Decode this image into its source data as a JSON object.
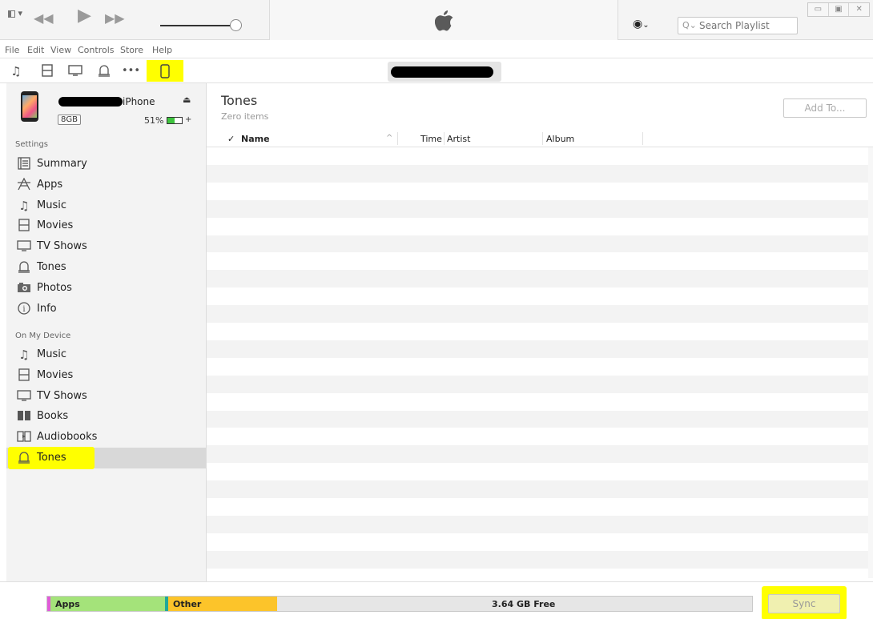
{
  "toolbar": {
    "search_placeholder": "Search Playlist",
    "volume_level": 1.0,
    "window_controls": [
      "▭",
      "▣",
      "✕"
    ]
  },
  "menu": [
    "File",
    "Edit",
    "View",
    "Controls",
    "Store",
    "Help"
  ],
  "media_icons": [
    "music-icon",
    "movies-icon",
    "tv-icon",
    "tones-icon",
    "more-icon",
    "device-icon"
  ],
  "device": {
    "name": "iPhone",
    "capacity": "8GB",
    "battery_percent": "51%",
    "battery_level": 0.51
  },
  "sidebar": {
    "settings_header": "Settings",
    "settings_items": [
      {
        "label": "Summary",
        "icon": "summary-icon"
      },
      {
        "label": "Apps",
        "icon": "apps-icon"
      },
      {
        "label": "Music",
        "icon": "music-icon"
      },
      {
        "label": "Movies",
        "icon": "movies-icon"
      },
      {
        "label": "TV Shows",
        "icon": "tv-icon"
      },
      {
        "label": "Tones",
        "icon": "bell-icon"
      },
      {
        "label": "Photos",
        "icon": "camera-icon"
      },
      {
        "label": "Info",
        "icon": "info-icon"
      }
    ],
    "device_header": "On My Device",
    "device_items": [
      {
        "label": "Music",
        "icon": "music-icon"
      },
      {
        "label": "Movies",
        "icon": "movies-icon"
      },
      {
        "label": "TV Shows",
        "icon": "tv-icon"
      },
      {
        "label": "Books",
        "icon": "books-icon"
      },
      {
        "label": "Audiobooks",
        "icon": "audiobook-icon"
      },
      {
        "label": "Tones",
        "icon": "bell-icon",
        "selected": true
      }
    ]
  },
  "main": {
    "title": "Tones",
    "subtitle": "Zero items",
    "add_to_label": "Add To...",
    "columns": {
      "check": "✓",
      "name": "Name",
      "time": "Time",
      "artist": "Artist",
      "album": "Album"
    }
  },
  "capacity": {
    "segments": [
      {
        "label": "Apps",
        "color": "#a4e37a"
      },
      {
        "label": "Other",
        "color": "#fcc42a"
      }
    ],
    "free_label": "3.64 GB Free",
    "sync_label": "Sync"
  },
  "colors": {
    "highlight": "#ffff00",
    "row_stripe": "#f3f3f3",
    "apps_marker": "#e05bd8",
    "other_marker": "#22a89a"
  }
}
